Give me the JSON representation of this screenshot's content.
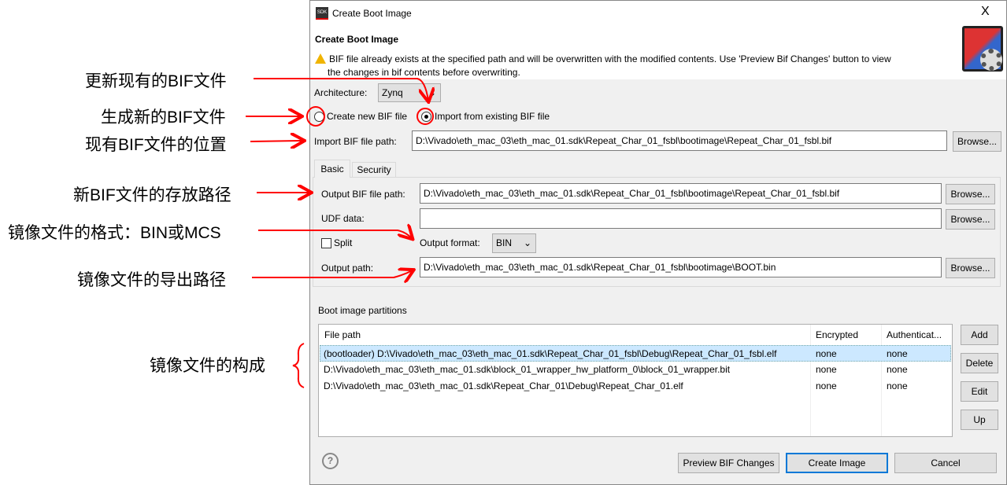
{
  "window": {
    "title": "Create Boot Image",
    "app_icon": "SDK",
    "close": "X"
  },
  "header": {
    "title": "Create Boot Image",
    "warning": "BIF file already exists at the specified path and will be overwritten with the modified contents. Use 'Preview Bif Changes' button to view",
    "warning2": "the changes in bif contents before overwriting."
  },
  "architecture": {
    "label": "Architecture:",
    "value": "Zynq"
  },
  "mode": {
    "create_label": "Create new BIF file",
    "import_label": "Import from existing BIF file",
    "selected": "import"
  },
  "import": {
    "label": "Import BIF file path:",
    "value": "D:\\Vivado\\eth_mac_03\\eth_mac_01.sdk\\Repeat_Char_01_fsbl\\bootimage\\Repeat_Char_01_fsbl.bif",
    "browse": "Browse..."
  },
  "tabs": [
    {
      "label": "Basic"
    },
    {
      "label": "Security"
    }
  ],
  "basic": {
    "output_bif_label": "Output BIF file path:",
    "output_bif_value": "D:\\Vivado\\eth_mac_03\\eth_mac_01.sdk\\Repeat_Char_01_fsbl\\bootimage\\Repeat_Char_01_fsbl.bif",
    "udf_label": "UDF data:",
    "udf_value": "",
    "split_label": "Split",
    "split_checked": false,
    "format_label": "Output format:",
    "format_value": "BIN",
    "output_path_label": "Output path:",
    "output_path_value": "D:\\Vivado\\eth_mac_03\\eth_mac_01.sdk\\Repeat_Char_01_fsbl\\bootimage\\BOOT.bin",
    "browse": "Browse..."
  },
  "partitions": {
    "title": "Boot image partitions",
    "columns": [
      "File path",
      "Encrypted",
      "Authenticat..."
    ],
    "rows": [
      [
        "(bootloader) D:\\Vivado\\eth_mac_03\\eth_mac_01.sdk\\Repeat_Char_01_fsbl\\Debug\\Repeat_Char_01_fsbl.elf",
        "none",
        "none"
      ],
      [
        "D:\\Vivado\\eth_mac_03\\eth_mac_01.sdk\\block_01_wrapper_hw_platform_0\\block_01_wrapper.bit",
        "none",
        "none"
      ],
      [
        "D:\\Vivado\\eth_mac_03\\eth_mac_01.sdk\\Repeat_Char_01\\Debug\\Repeat_Char_01.elf",
        "none",
        "none"
      ]
    ],
    "buttons": {
      "add": "Add",
      "delete": "Delete",
      "edit": "Edit",
      "up": "Up"
    }
  },
  "footer": {
    "help": "?",
    "preview": "Preview BIF Changes",
    "create": "Create Image",
    "cancel": "Cancel"
  },
  "annotations": {
    "a1": "更新现有的BIF文件",
    "a2": "生成新的BIF文件",
    "a3": "现有BIF文件的位置",
    "a4": "新BIF文件的存放路径",
    "a5": "镜像文件的格式：BIN或MCS",
    "a6": "镜像文件的导出路径",
    "a7": "镜像文件的构成"
  },
  "colors": {
    "annotation": "#ff0000",
    "selection": "#cce8ff",
    "primary_border": "#0078d7"
  }
}
